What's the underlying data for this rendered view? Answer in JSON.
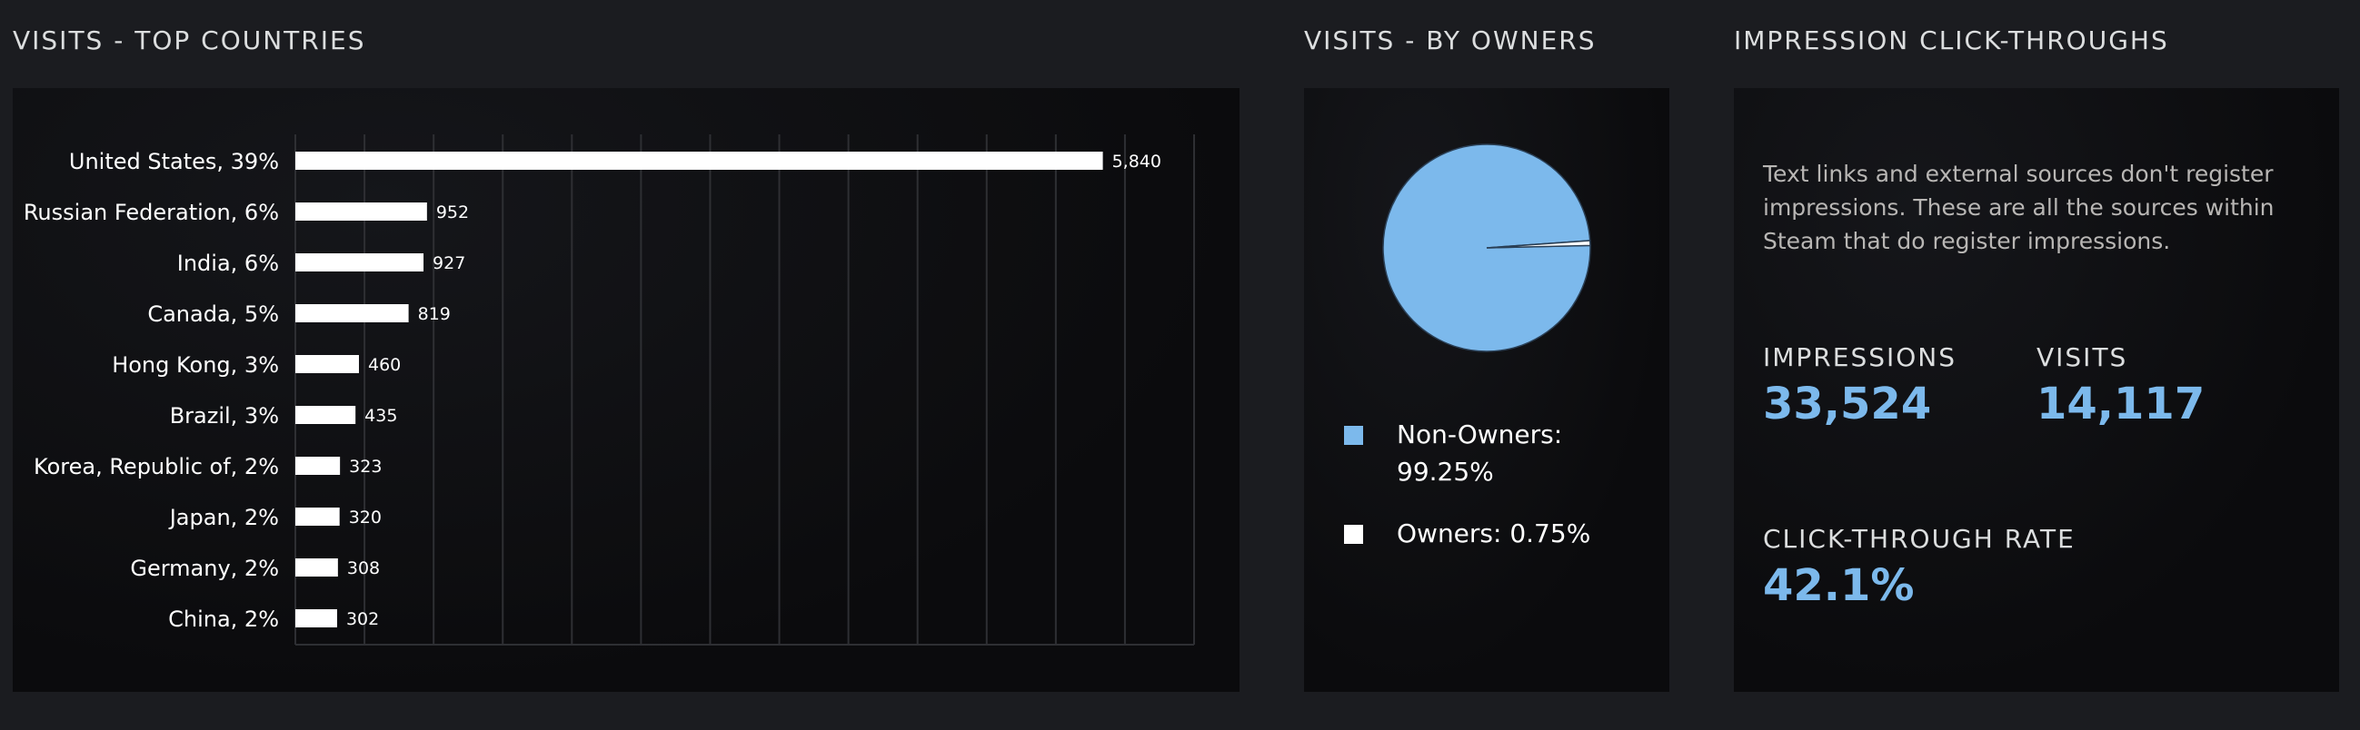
{
  "sections": {
    "countries_title": "VISITS - TOP COUNTRIES",
    "owners_title": "VISITS - BY OWNERS",
    "ctr_title": "IMPRESSION CLICK-THROUGHS"
  },
  "chart_data": [
    {
      "type": "bar",
      "orientation": "horizontal",
      "title": "VISITS - TOP COUNTRIES",
      "categories": [
        "United States, 39%",
        "Russian Federation, 6%",
        "India, 6%",
        "Canada, 5%",
        "Hong Kong, 3%",
        "Brazil, 3%",
        "Korea, Republic of, 2%",
        "Japan, 2%",
        "Germany, 2%",
        "China, 2%"
      ],
      "values": [
        5840,
        952,
        927,
        819,
        460,
        435,
        323,
        320,
        308,
        302
      ],
      "value_labels": [
        "5,840",
        "952",
        "927",
        "819",
        "460",
        "435",
        "323",
        "320",
        "308",
        "302"
      ],
      "xlim": [
        0,
        6500
      ],
      "grid": true,
      "bar_color": "#ffffff"
    },
    {
      "type": "pie",
      "title": "VISITS - BY OWNERS",
      "slices": [
        {
          "label": "Non-Owners",
          "value": 99.25,
          "legend": "Non-Owners: 99.25%",
          "color": "#7cb9ec"
        },
        {
          "label": "Owners",
          "value": 0.75,
          "legend": "Owners: 0.75%",
          "color": "#ffffff"
        }
      ],
      "legend_position": "bottom"
    }
  ],
  "ctr": {
    "description": "Text links and external sources don't register impressions. These are all the sources within Steam that do register impressions.",
    "impressions_label": "IMPRESSIONS",
    "impressions_value": "33,524",
    "visits_label": "VISITS",
    "visits_value": "14,117",
    "rate_label": "CLICK-THROUGH RATE",
    "rate_value": "42.1%",
    "accent_color": "#7cb9ec"
  }
}
